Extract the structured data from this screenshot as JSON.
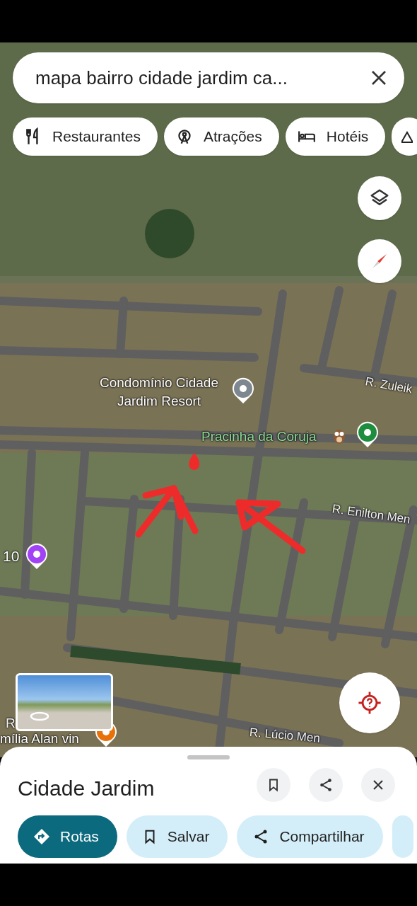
{
  "search": {
    "value": "mapa bairro cidade jardim ca..."
  },
  "chips": [
    {
      "kind": "restaurants",
      "label": "Restaurantes"
    },
    {
      "kind": "attractions",
      "label": "Atrações"
    },
    {
      "kind": "hotels",
      "label": "Hotéis"
    },
    {
      "kind": "partial"
    }
  ],
  "map_labels": [
    {
      "kind": "place",
      "text": "Condomínio Cidade Jardim Resort"
    },
    {
      "kind": "park",
      "text": "Pracinha da Coruja"
    },
    {
      "kind": "street",
      "text": "R. Zuleik"
    },
    {
      "kind": "street",
      "text": "R. Enilton Men"
    },
    {
      "kind": "place",
      "text": "10"
    },
    {
      "kind": "street",
      "text": "R"
    },
    {
      "kind": "place",
      "text": "mília Alan vin"
    },
    {
      "kind": "street",
      "text": "R. Lúcio Men"
    }
  ],
  "place": {
    "title": "Cidade Jardim"
  },
  "actions": [
    {
      "kind": "directions",
      "label": "Rotas"
    },
    {
      "kind": "save",
      "label": "Salvar"
    },
    {
      "kind": "share",
      "label": "Compartilhar"
    },
    {
      "kind": "partial"
    }
  ]
}
